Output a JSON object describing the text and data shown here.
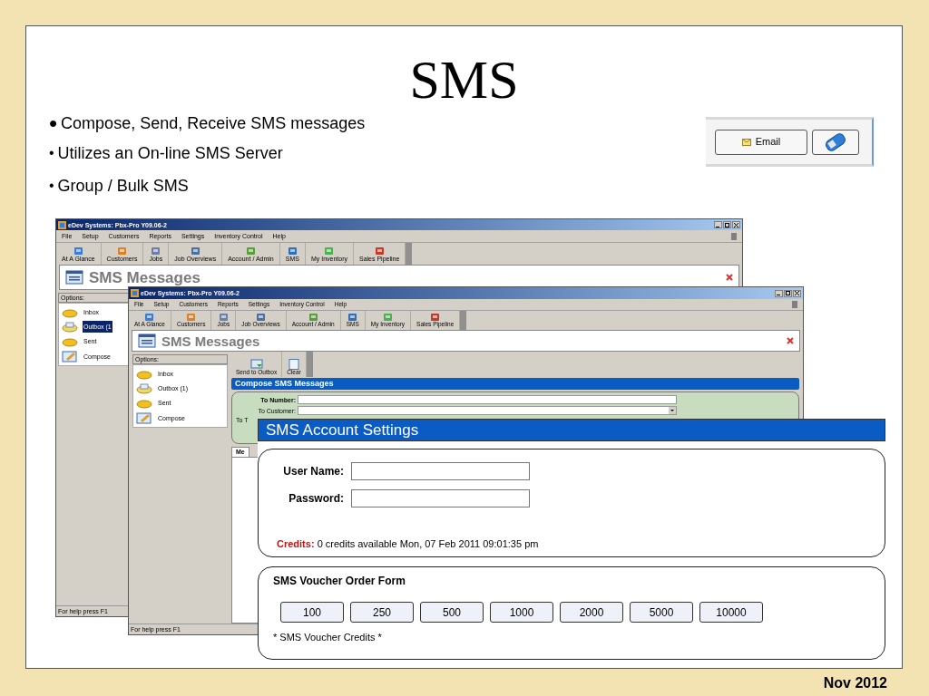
{
  "slide": {
    "title": "SMS",
    "bullets": [
      {
        "kind": "major",
        "marker": "•",
        "text": "Compose, Send, Receive SMS messages"
      },
      {
        "kind": "minor",
        "marker": "•",
        "text": "Utilizes an On-line SMS Server"
      },
      {
        "kind": "minor",
        "marker": "•",
        "text": "Group / Bulk SMS"
      }
    ],
    "footer": "Nov 2012"
  },
  "button_strip": {
    "buttons": [
      {
        "kind": "email",
        "label": "Email"
      },
      {
        "kind": "phone"
      }
    ]
  },
  "back_window": {
    "title": "eDev Systems: Pbx-Pro Y09.06-2",
    "menu": [
      "File",
      "Setup",
      "Customers",
      "Reports",
      "Settings",
      "Inventory Control",
      "Help"
    ],
    "toolbar": [
      "At A Glance",
      "Customers",
      "Jobs",
      "Job Overviews",
      "Account / Admin",
      "SMS",
      "My Inventory",
      "Sales Pipeline"
    ],
    "header": "SMS Messages",
    "options_label": "Options:",
    "options": [
      {
        "kind": "inbox",
        "label": "Inbox",
        "selected": false
      },
      {
        "kind": "outbox",
        "label": "Outbox (1",
        "selected": true
      },
      {
        "kind": "sent",
        "label": "Sent",
        "selected": false
      },
      {
        "kind": "compose",
        "label": "Compose",
        "selected": false
      }
    ],
    "status": "For help press F1"
  },
  "front_window": {
    "title": "eDev Systems: Pbx-Pro Y09.06-2",
    "menu": [
      "File",
      "Setup",
      "Customers",
      "Reports",
      "Settings",
      "Inventory Control",
      "Help"
    ],
    "toolbar": [
      "At A Glance",
      "Customers",
      "Jobs",
      "Job Overviews",
      "Account / Admin",
      "SMS",
      "My Inventory",
      "Sales Pipeline"
    ],
    "header": "SMS Messages",
    "options_label": "Options:",
    "options": [
      {
        "kind": "inbox",
        "label": "Inbox",
        "selected": false
      },
      {
        "kind": "outbox",
        "label": "Outbox (1)",
        "selected": false
      },
      {
        "kind": "sent",
        "label": "Sent",
        "selected": false
      },
      {
        "kind": "compose",
        "label": "Compose",
        "selected": false
      }
    ],
    "actions": [
      {
        "kind": "send",
        "label": "Send to Outbox"
      },
      {
        "kind": "clear",
        "label": "Clear"
      }
    ],
    "compose_title": "Compose SMS Messages",
    "fields": [
      {
        "kind": "text",
        "label": "To Number:"
      },
      {
        "kind": "dropdown",
        "label": "To Customer:"
      },
      {
        "kind": "cut",
        "label": "To T"
      }
    ],
    "tab": "Me",
    "status": "For help press F1"
  },
  "settings": {
    "title": "SMS Account Settings",
    "fields": [
      {
        "label": "User Name:"
      },
      {
        "label": "Password:"
      }
    ],
    "credits_label": "Credits:",
    "credits_text": "0 credits available Mon, 07 Feb 2011 09:01:35 pm",
    "voucher_title": "SMS Voucher Order Form",
    "vouchers": [
      "100",
      "250",
      "500",
      "1000",
      "2000",
      "5000",
      "10000"
    ],
    "note": "* SMS Voucher Credits *"
  }
}
